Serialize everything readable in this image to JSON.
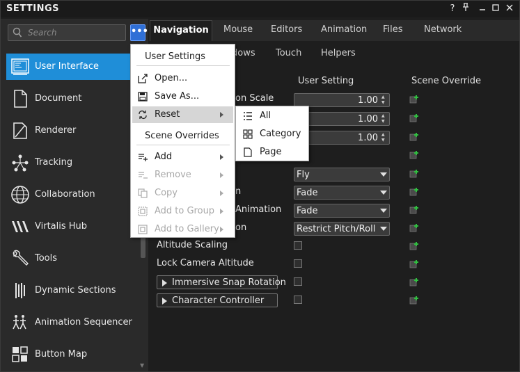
{
  "window": {
    "title": "SETTINGS",
    "help_label": "?",
    "pin_label": "⊥",
    "minimize_label": "–",
    "maximize_label": "□",
    "close_label": "✕"
  },
  "search": {
    "placeholder": "Search"
  },
  "more_button": {
    "label": "•••"
  },
  "sidebar": {
    "items": [
      {
        "label": "User Interface",
        "icon": "user-interface-icon",
        "selected": true
      },
      {
        "label": "Document",
        "icon": "document-icon"
      },
      {
        "label": "Renderer",
        "icon": "renderer-icon"
      },
      {
        "label": "Tracking",
        "icon": "tracking-icon"
      },
      {
        "label": "Collaboration",
        "icon": "collaboration-icon"
      },
      {
        "label": "Virtalis Hub",
        "icon": "virtalis-hub-icon"
      },
      {
        "label": "Tools",
        "icon": "tools-icon"
      },
      {
        "label": "Dynamic Sections",
        "icon": "dynamic-sections-icon"
      },
      {
        "label": "Animation Sequencer",
        "icon": "animation-sequencer-icon"
      },
      {
        "label": "Button Map",
        "icon": "button-map-icon"
      }
    ]
  },
  "tabs": {
    "primary": [
      "Navigation",
      "Mouse",
      "Editors",
      "Animation",
      "Files",
      "Network"
    ],
    "active": "Navigation",
    "secondary": [
      "dows",
      "Touch",
      "Helpers"
    ]
  },
  "columns": {
    "user_setting": "User Setting",
    "scene_override": "Scene Override"
  },
  "rows": {
    "r1": {
      "label": "on Scale",
      "value": "1.00"
    },
    "r2": {
      "value": "1.00"
    },
    "r3": {
      "value": "1.00"
    },
    "r4": {
      "value": "Fly"
    },
    "r5": {
      "label": "n",
      "value": "Fade"
    },
    "r6": {
      "label": "Animation",
      "value": "Fade"
    },
    "r7": {
      "label": "on",
      "value": "Restrict Pitch/Roll…"
    },
    "r8": {
      "label": "Altitude Scaling",
      "checked": false
    },
    "r9": {
      "label": "Lock Camera Altitude",
      "checked": false
    },
    "r10": {
      "label": "Immersive Snap Rotation",
      "checked": false
    },
    "r11": {
      "label": "Character Controller",
      "checked": false
    }
  },
  "menu": {
    "header_user": "User Settings",
    "open": "Open...",
    "save_as": "Save As...",
    "reset": "Reset",
    "header_scene": "Scene Overrides",
    "add": "Add",
    "remove": "Remove",
    "copy": "Copy",
    "add_to_group": "Add to Group",
    "add_to_gallery": "Add to Gallery"
  },
  "submenu": {
    "all": "All",
    "category": "Category",
    "page": "Page"
  },
  "colors": {
    "accent": "#1f8ed8",
    "button_blue": "#2f6fd6",
    "override_green": "#2fbf3f"
  }
}
